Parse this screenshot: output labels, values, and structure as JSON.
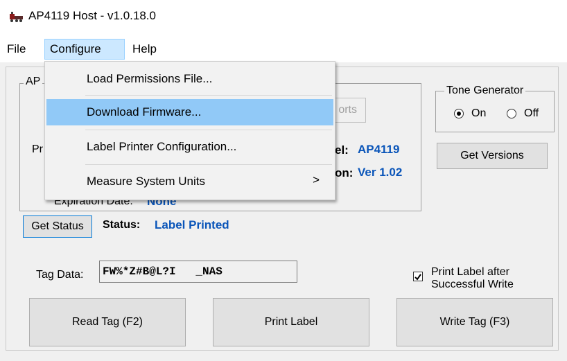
{
  "window": {
    "title": "AP4119 Host - v1.0.18.0",
    "app_icon": "train-icon"
  },
  "menubar": {
    "file": "File",
    "configure": "Configure",
    "help": "Help"
  },
  "configure_menu": {
    "items": [
      "Load Permissions File...",
      "Download Firmware...",
      "Label Printer Configuration...",
      "Measure System Units"
    ],
    "highlighted": "Download Firmware...",
    "submenu_arrow": ">"
  },
  "group": {
    "title": "AP"
  },
  "ports_button_fragment": "orts",
  "printer_label_fragment": "Pr",
  "model": {
    "label_fragment": "el:",
    "value": "AP4119"
  },
  "version": {
    "label_fragment": "on:",
    "value": "Ver 1.02"
  },
  "expiration": {
    "label": "Expiration Date:",
    "value": "None"
  },
  "tone_generator": {
    "title": "Tone Generator",
    "on_label": "On",
    "off_label": "Off",
    "selected": "On"
  },
  "get_versions_button": "Get Versions",
  "get_status_button": "Get Status",
  "status": {
    "label": "Status:",
    "value": "Label Printed"
  },
  "tag_data": {
    "label": "Tag Data:",
    "value": "FW%*Z#B@L?I   _NAS"
  },
  "print_label_after": {
    "label_line1": "Print Label after",
    "label_line2": "Successful Write",
    "checked": true
  },
  "buttons": {
    "read_tag": "Read Tag (F2)",
    "print_label": "Print Label",
    "write_tag": "Write Tag (F3)"
  },
  "colors": {
    "accent_value": "#0a55b9",
    "menu_highlight": "#91c9f7",
    "menu_active": "#cce8ff"
  }
}
